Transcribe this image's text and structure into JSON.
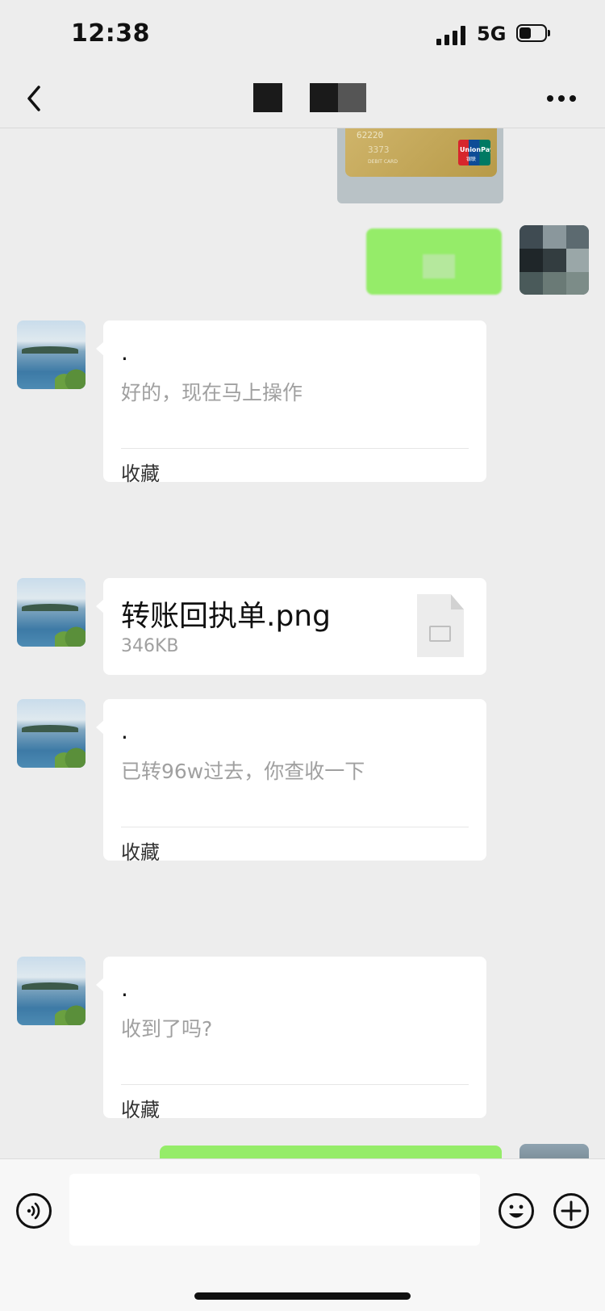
{
  "status_bar": {
    "time": "12:38",
    "network": "5G"
  },
  "nav": {
    "back_icon": "chevron-left-icon",
    "more_icon": "ellipsis-icon"
  },
  "top_photo": {
    "card_number": "62220",
    "card_code": "3373",
    "card_type": "DEBIT CARD",
    "card_brand": "UnionPay",
    "card_brand_cn": "银联"
  },
  "messages": [
    {
      "side": "left",
      "type": "quote",
      "dot": ".",
      "text": "好的，现在马上操作",
      "action": "收藏"
    },
    {
      "side": "left",
      "type": "file",
      "file_name": "转账回执单.png",
      "file_size": "346KB"
    },
    {
      "side": "left",
      "type": "quote",
      "dot": ".",
      "text": "已转96w过去，你查收一下",
      "action": "收藏"
    },
    {
      "side": "left",
      "type": "quote",
      "dot": ".",
      "text": "收到了吗?",
      "action": "收藏"
    }
  ],
  "input_bar": {
    "voice_icon": "voice-icon",
    "emoji_icon": "emoji-icon",
    "add_icon": "plus-icon",
    "text_value": ""
  },
  "colors": {
    "background": "#ededed",
    "bubble_self": "#95ec69",
    "bubble_other": "#ffffff"
  }
}
